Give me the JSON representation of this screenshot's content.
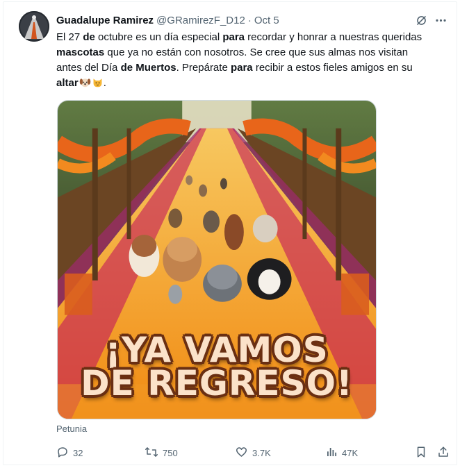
{
  "tweet": {
    "author_name": "Guadalupe Ramirez",
    "author_handle": "@GRamirezF_D12",
    "separator": "·",
    "date": "Oct 5",
    "text_segments": [
      {
        "t": "El 27 ",
        "b": false
      },
      {
        "t": "de",
        "b": true
      },
      {
        "t": " octubre es un día especial ",
        "b": false
      },
      {
        "t": "para",
        "b": true
      },
      {
        "t": " recordar y honrar a nuestras queridas ",
        "b": false
      },
      {
        "t": "mascotas",
        "b": true
      },
      {
        "t": " que ya no están con nosotros. Se cree que sus almas nos visitan antes del Día ",
        "b": false
      },
      {
        "t": "de Muertos",
        "b": true
      },
      {
        "t": ". Prepárate ",
        "b": false
      },
      {
        "t": "para",
        "b": true
      },
      {
        "t": " recibir a estos fieles amigos en su ",
        "b": false
      },
      {
        "t": "altar",
        "b": true
      }
    ],
    "text_end": ".",
    "emojis": [
      "dog-face-emoji",
      "cat-face-emoji"
    ],
    "image": {
      "headline_line1": "¡YA VAMOS",
      "headline_line2": "DE REGRESO!"
    },
    "image_caption": "Petunia"
  },
  "icons": {
    "grok": "grok-icon",
    "more": "more-options-icon"
  },
  "actions": {
    "replies": "32",
    "reposts": "750",
    "likes": "3.7K",
    "views": "47K"
  },
  "colors": {
    "text": "#0f1419",
    "secondary": "#536471",
    "marigold": "#f39a1e",
    "magenta": "#b0246b"
  }
}
